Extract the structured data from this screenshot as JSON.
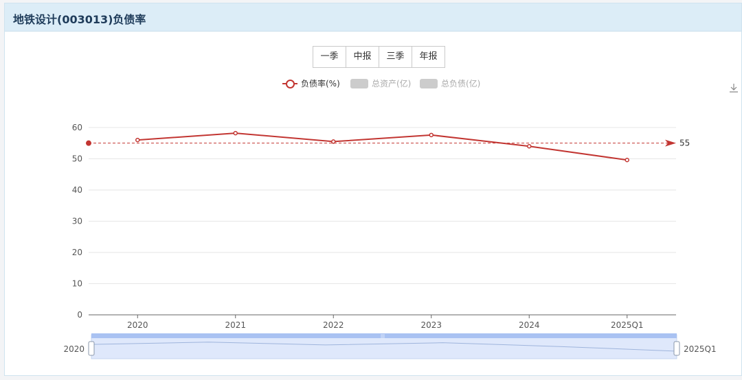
{
  "header": {
    "title": "地铁设计(003013)负债率"
  },
  "tabs": [
    {
      "label": "一季"
    },
    {
      "label": "中报"
    },
    {
      "label": "三季"
    },
    {
      "label": "年报"
    }
  ],
  "legend": [
    {
      "label": "负债率(%)",
      "active": true,
      "color": "#c23531"
    },
    {
      "label": "总资产(亿)",
      "active": false,
      "color": "#cccccc"
    },
    {
      "label": "总负债(亿)",
      "active": false,
      "color": "#cccccc"
    }
  ],
  "toolbox": {
    "icon": "download-icon"
  },
  "chart_data": {
    "type": "line",
    "categories": [
      "2020",
      "2021",
      "2022",
      "2023",
      "2024",
      "2025Q1"
    ],
    "series": [
      {
        "name": "负债率(%)",
        "values": [
          56.0,
          58.2,
          55.5,
          57.6,
          54.0,
          49.6
        ],
        "color": "#c23531"
      }
    ],
    "y_ticks": [
      0,
      10,
      20,
      30,
      40,
      50,
      60
    ],
    "ylim": [
      0,
      63.5
    ],
    "markline": {
      "value": 55,
      "label": "55"
    },
    "grid": "horizontal",
    "legend_position": "top-center",
    "datazoom": {
      "start_label": "2020",
      "end_label": "2025Q1"
    }
  }
}
